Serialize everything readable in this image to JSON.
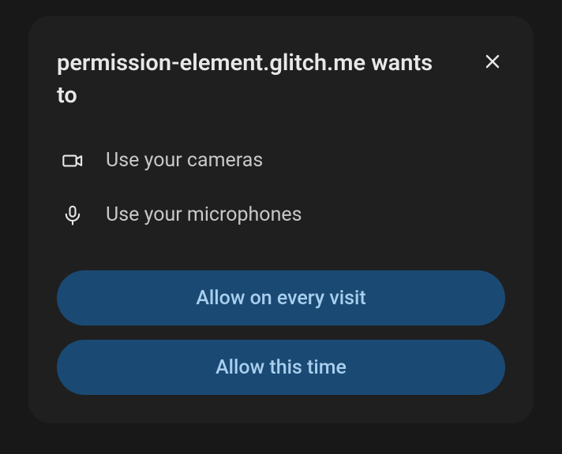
{
  "dialog": {
    "origin": "permission-element.glitch.me",
    "title_suffix": "wants to",
    "permissions": [
      {
        "icon": "camera-icon",
        "label": "Use your cameras"
      },
      {
        "icon": "microphone-icon",
        "label": "Use your microphones"
      }
    ],
    "buttons": {
      "allow_every": "Allow on every visit",
      "allow_once": "Allow this time"
    }
  }
}
